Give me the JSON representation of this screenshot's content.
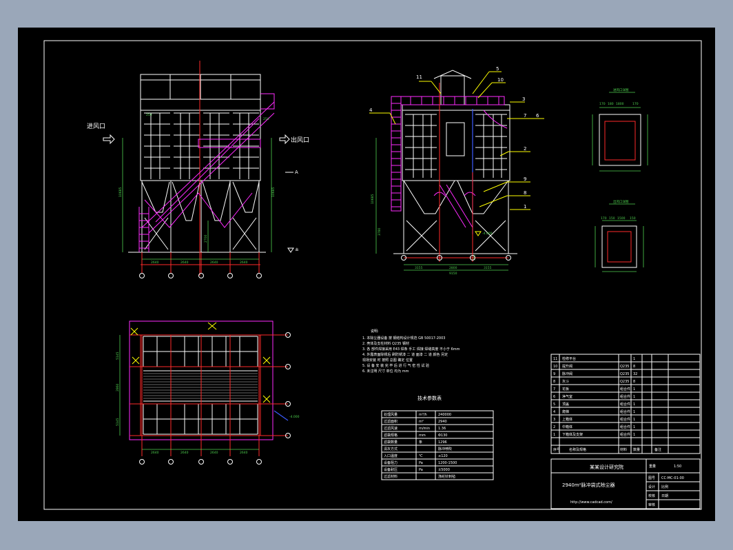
{
  "drawing": {
    "front_view": {
      "inlet_label": "进风口",
      "outlet_label": "出风口",
      "section_mark": "A",
      "ground_mark": "±",
      "dim_bays": [
        "2640",
        "2640",
        "2640",
        "2640"
      ],
      "dim_left_height": "10685",
      "dim_right_height": "10685",
      "dim_top": "250",
      "dim_leg": "2700"
    },
    "side_view": {
      "callouts": [
        "1",
        "2",
        "3",
        "4",
        "5",
        "6",
        "7",
        "8",
        "9",
        "10",
        "11"
      ],
      "dim_bays": [
        "3155",
        "2800",
        "3155"
      ],
      "dim_total": "9150",
      "dim_small": "300",
      "dim_left_height": "10685",
      "dim_leg": "3780",
      "elev_mark": "-4.000"
    },
    "plan_view": {
      "dim_bays": [
        "2640",
        "2640",
        "2640",
        "2640"
      ],
      "dim_left_top": "5145",
      "dim_left_mid": "2860",
      "dim_left_bot": "5145",
      "elev_mark": "-4.000"
    },
    "detail_views": {
      "top_detail_title": "进风口详图",
      "top_dims": [
        "170",
        "180",
        "1800",
        "170"
      ],
      "bottom_detail_title": "出风口详图",
      "bottom_dims": [
        "170",
        "150",
        "1500",
        "150"
      ]
    },
    "notes": {
      "title": "说明:",
      "lines": [
        "1. 本除尘器设备 按 钢结构设计规范 GB 50017-2003",
        "2. 壳体及支柱材料 Q235 钢材",
        "3. 各 部件焊接采用 E43 焊条 手工 焊接 焊缝高度 不小于 6mm",
        "4. 外露表面除锈后 刷防锈漆 二 道 面漆 二 道 颜色 另定",
        "   现场安装 时 按照 总图 确定 位置",
        "5. 设 备 安 装 完 毕 后 进 行 气 密 性 试 验",
        "6. 未注明 尺寸 单位 均为 mm"
      ]
    },
    "tech_table": {
      "title": "技术参数表",
      "rows": [
        [
          "处理风量",
          "m³/h",
          "240000"
        ],
        [
          "过滤面积",
          "m²",
          "2940"
        ],
        [
          "过滤风速",
          "m/min",
          "1.36"
        ],
        [
          "滤袋规格",
          "mm",
          "Φ130"
        ],
        [
          "滤袋数量",
          "条",
          "1296"
        ],
        [
          "清灰方式",
          "",
          "脉冲喷吹"
        ],
        [
          "入口温度",
          "℃",
          "≤120"
        ],
        [
          "设备阻力",
          "Pa",
          "1200-1500"
        ],
        [
          "设备耐压",
          "Pa",
          "±5000"
        ],
        [
          "过滤材料",
          "",
          "涤纶针刺毡"
        ]
      ]
    },
    "parts_list": {
      "rows": [
        [
          "11",
          "检修平台",
          "",
          "1",
          ""
        ],
        [
          "10",
          "提升阀",
          "Q235",
          "8",
          ""
        ],
        [
          "9",
          "脉冲阀",
          "Q235",
          "32",
          ""
        ],
        [
          "8",
          "灰斗",
          "Q235",
          "8",
          ""
        ],
        [
          "7",
          "花板",
          "组合件",
          "1",
          ""
        ],
        [
          "6",
          "净气室",
          "组合件",
          "1",
          ""
        ],
        [
          "5",
          "顶盖",
          "组合件",
          "1",
          ""
        ],
        [
          "4",
          "爬梯",
          "组合件",
          "1",
          ""
        ],
        [
          "3",
          "上箱体",
          "组合件",
          "1",
          ""
        ],
        [
          "2",
          "中箱体",
          "组合件",
          "1",
          ""
        ],
        [
          "1",
          "下箱体及支架",
          "组合件",
          "1",
          ""
        ]
      ],
      "header": [
        "序号",
        "名称及规格",
        "材料",
        "数量",
        "备注"
      ]
    },
    "title_block": {
      "drawing_title": "2940m²脉冲袋式除尘器",
      "company": "某某设计研究院",
      "site": "http://www.cadcad.com/",
      "drawing_no": "CC-MC-01-00",
      "scale_label": "比例",
      "scale": "1:50",
      "design_label": "设计",
      "check_label": "校核",
      "approve_label": "审核",
      "date_label": "日期",
      "sheet_label": "图号",
      "mass_label": "重量"
    }
  }
}
